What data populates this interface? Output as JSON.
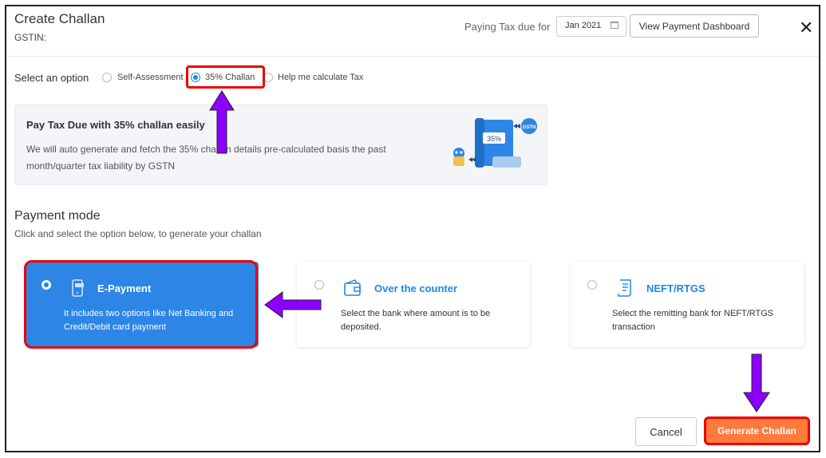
{
  "header": {
    "title": "Create Challan",
    "gstin_label": "GSTIN:",
    "paying_label": "Paying Tax due for",
    "period_value": "Jan 2021",
    "dashboard_button": "View Payment Dashboard",
    "close_glyph": "✕"
  },
  "options": {
    "label": "Select an option",
    "items": [
      {
        "label": "Self-Assessment",
        "selected": false
      },
      {
        "label": "35% Challan",
        "selected": true
      },
      {
        "label": "Help me calculate Tax",
        "selected": false
      }
    ]
  },
  "info": {
    "title": "Pay Tax Due with 35% challan easily",
    "description": "We will auto generate and fetch the 35% challan details pre-calculated basis the past month/quarter tax liability by GSTN",
    "illustration_badge": "35%",
    "illustration_logo": "GSTN"
  },
  "payment_mode": {
    "title": "Payment mode",
    "subtitle": "Click and select the option below, to generate your challan",
    "cards": [
      {
        "title": "E-Payment",
        "description": "It includes two options like Net Banking and Credit/Debit card payment",
        "selected": true,
        "icon": "mobile-payment-icon"
      },
      {
        "title": "Over the counter",
        "description": "Select the bank where amount is to be deposited.",
        "selected": false,
        "icon": "wallet-icon"
      },
      {
        "title": "NEFT/RTGS",
        "description": "Select the remitting bank for NEFT/RTGS transaction",
        "selected": false,
        "icon": "document-icon"
      }
    ]
  },
  "footer": {
    "cancel_label": "Cancel",
    "generate_label": "Generate Challan"
  },
  "colors": {
    "accent": "#1f87e5",
    "highlight_border": "#e00000",
    "annotation_arrow": "#8b00ff",
    "generate_button": "#ff7a3d"
  }
}
